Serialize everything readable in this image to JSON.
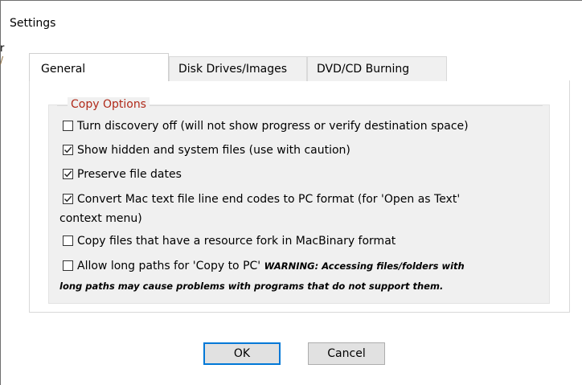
{
  "window": {
    "title": "Settings"
  },
  "background": {
    "char1": "r",
    "char2": "/"
  },
  "tabs": [
    {
      "label": "General",
      "active": true
    },
    {
      "label": "Disk Drives/Images",
      "active": false
    },
    {
      "label": "DVD/CD Burning",
      "active": false
    }
  ],
  "copy_options": {
    "legend": "Copy Options",
    "options": [
      {
        "label": "Turn discovery off (will not show progress or verify destination space)",
        "checked": false
      },
      {
        "label": "Show hidden and system files (use with caution)",
        "checked": true
      },
      {
        "label": "Preserve file dates",
        "checked": true
      },
      {
        "label": "Convert Mac text file line end codes to PC format (for 'Open as Text'",
        "label_cont": "context menu)",
        "checked": true
      },
      {
        "label": "Copy files that have a resource fork in MacBinary format",
        "checked": false
      },
      {
        "label": "Allow long paths for 'Copy to PC'",
        "warning": "WARNING: Accessing files/folders with",
        "warning_cont": "long paths may cause problems with programs that do not support them.",
        "checked": false
      }
    ]
  },
  "buttons": {
    "ok": "OK",
    "cancel": "Cancel"
  },
  "colors": {
    "legend": "#b02a1a",
    "focus": "#0078d7",
    "group_bg": "#f0f0f0"
  }
}
